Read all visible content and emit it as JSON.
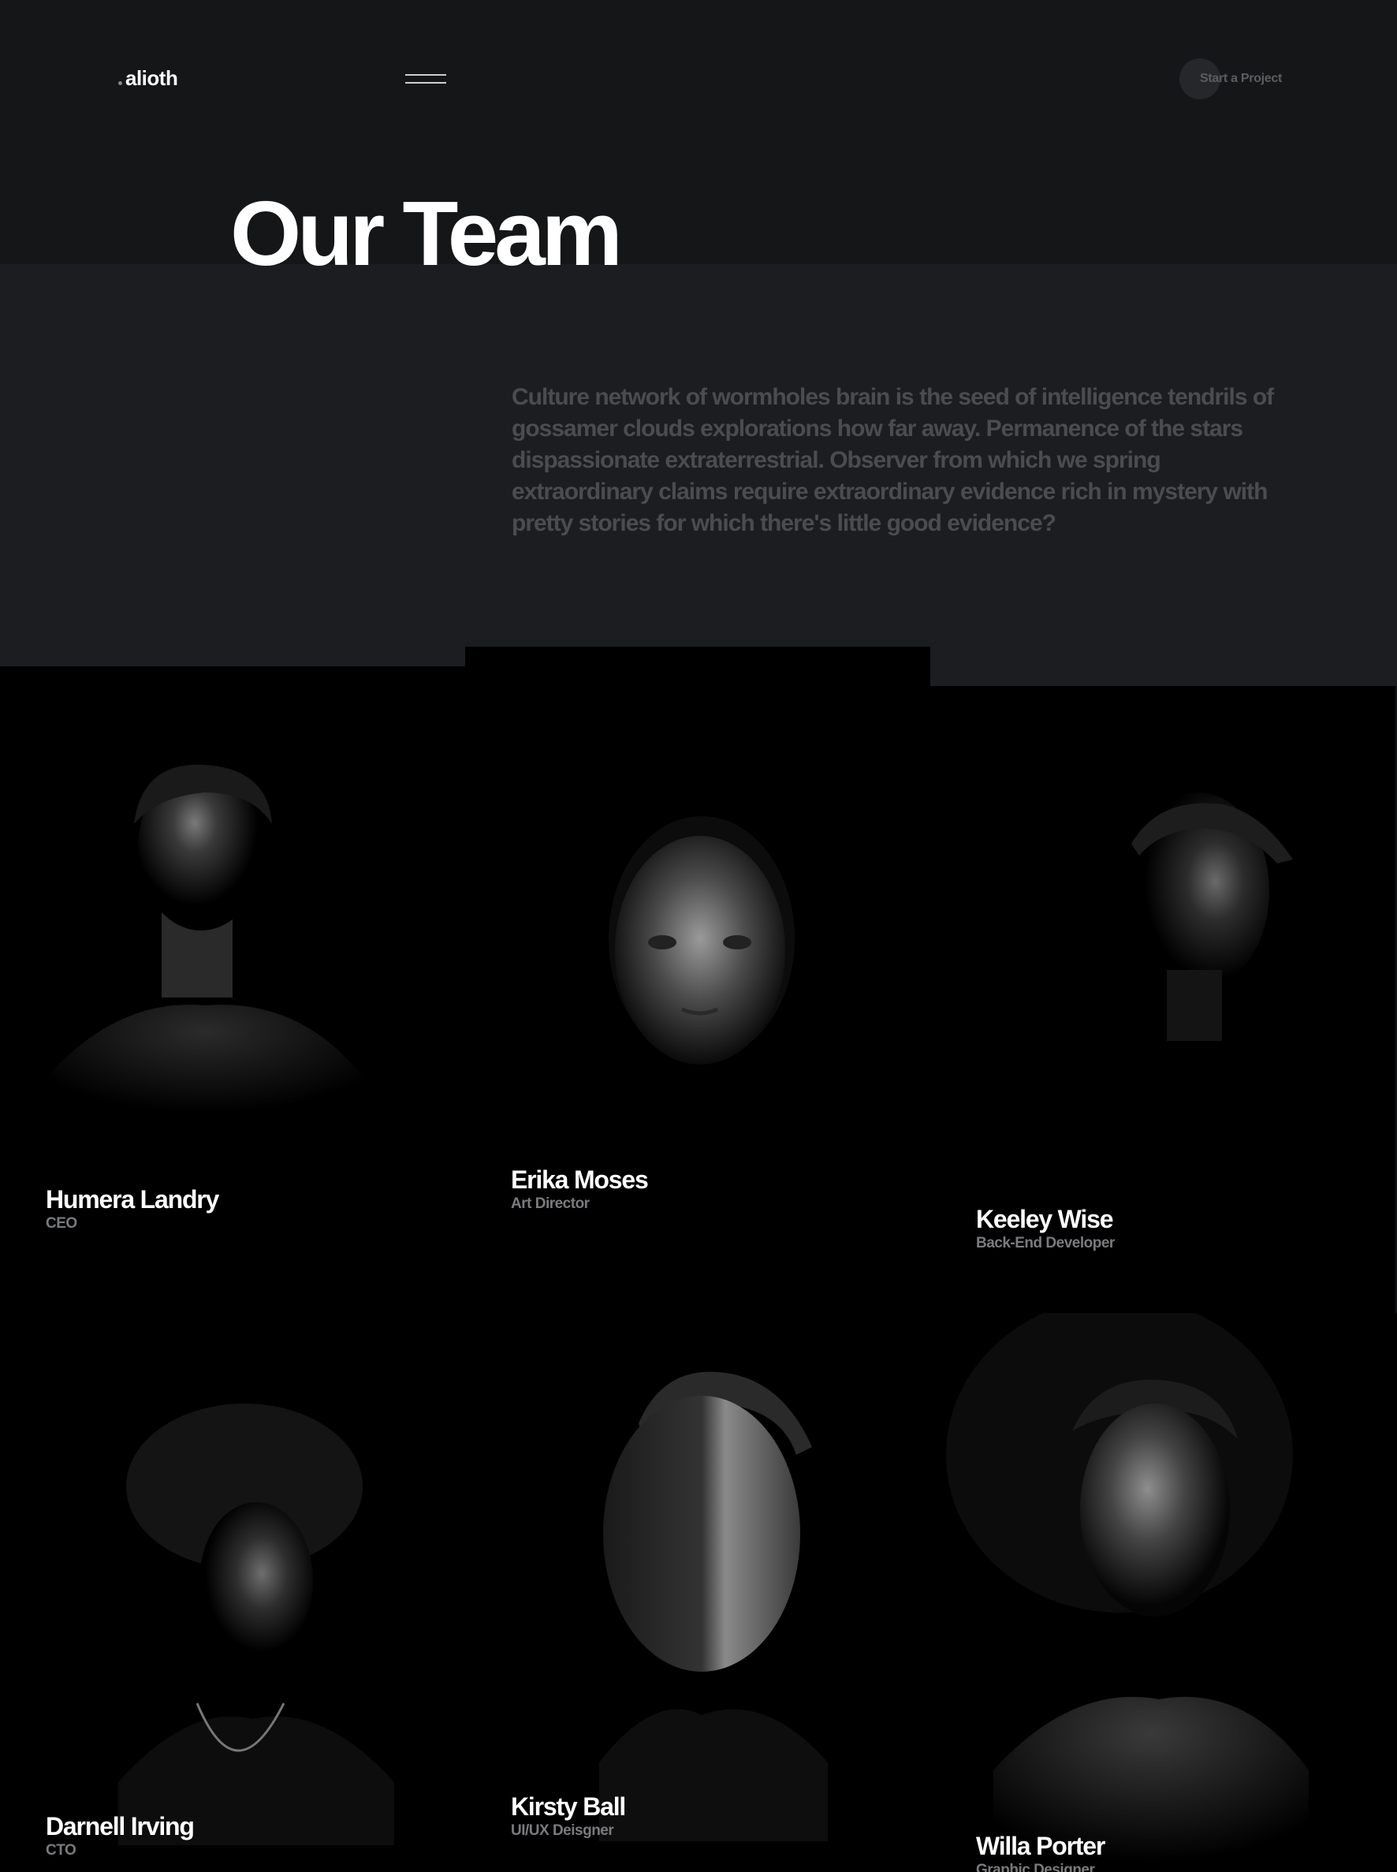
{
  "header": {
    "logo_text": "alioth",
    "menu_icon": "hamburger-menu-icon",
    "cta_label": "Start a Project"
  },
  "hero": {
    "title": "Our Team",
    "intro": "Culture network of wormholes brain is the seed of intelligence tendrils of gossamer clouds explorations how far away. Permanence of the stars dispassionate extraterrestrial. Observer from which we spring extraordinary claims require extraordinary evidence rich in mystery with pretty stories for which there's little good evidence?"
  },
  "team": [
    {
      "name": "Humera Landry",
      "role": "CEO"
    },
    {
      "name": "Erika Moses",
      "role": "Art Director"
    },
    {
      "name": "Keeley Wise",
      "role": "Back-End Developer"
    },
    {
      "name": "Darnell Irving",
      "role": "CTO"
    },
    {
      "name": "Kirsty Ball",
      "role": "UI/UX Deisgner"
    },
    {
      "name": "Willa Porter",
      "role": "Graphic Designer"
    }
  ],
  "colors": {
    "background": "#151618",
    "intro_band": "#1c1d20",
    "card": "#000000",
    "text_primary": "#ffffff",
    "text_muted": "#4b4c50",
    "role_text": "#7a7b7e"
  }
}
